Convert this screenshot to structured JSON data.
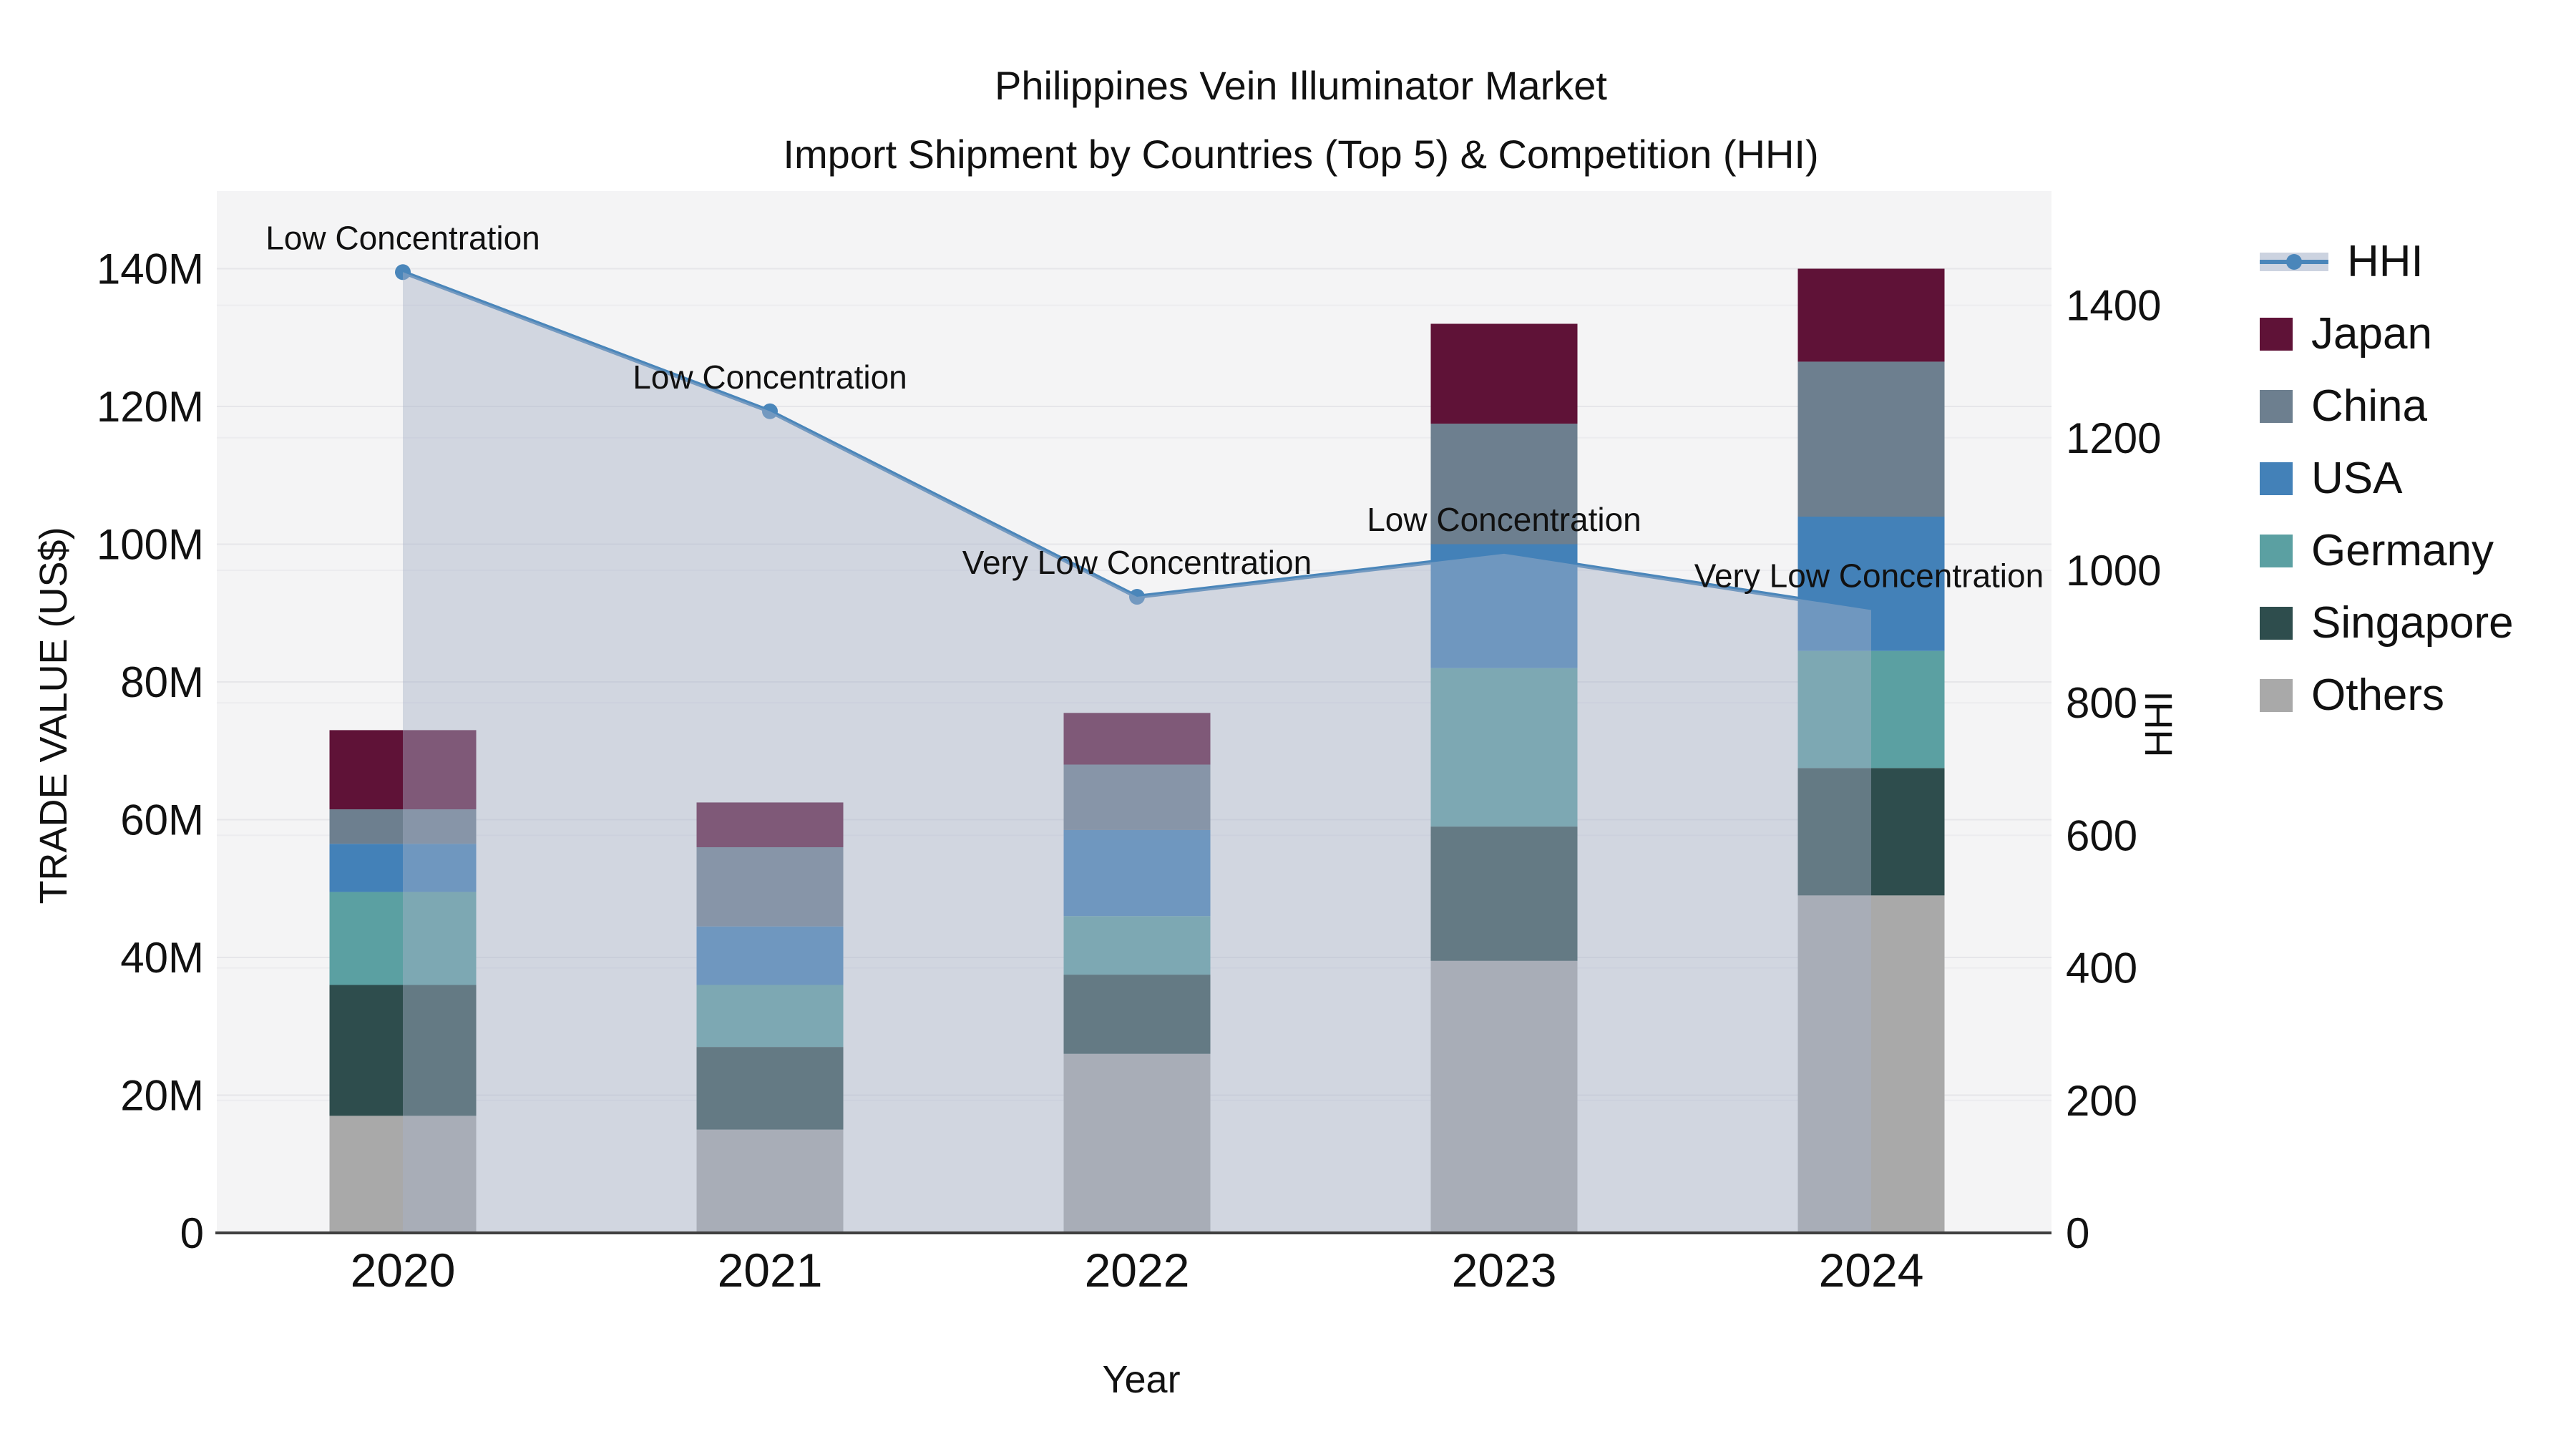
{
  "title": {
    "line1": "Philippines Vein Illuminator Market",
    "line2": "Import Shipment by Countries (Top 5) & Competition (HHI)"
  },
  "axes": {
    "left": {
      "label": "TRADE VALUE (US$)",
      "tick_labels": [
        "0",
        "20M",
        "40M",
        "60M",
        "80M",
        "100M",
        "120M",
        "140M"
      ],
      "tick_values": [
        0,
        20,
        40,
        60,
        80,
        100,
        120,
        140
      ]
    },
    "right": {
      "label": "HHI",
      "tick_labels": [
        "0",
        "200",
        "400",
        "600",
        "800",
        "1000",
        "1200",
        "1400"
      ],
      "tick_values": [
        0,
        200,
        400,
        600,
        800,
        1000,
        1200,
        1400
      ]
    },
    "x": {
      "label": "Year"
    }
  },
  "legend": [
    {
      "label": "HHI",
      "type": "line",
      "color": "#4a86ba"
    },
    {
      "label": "Japan",
      "type": "box",
      "color": "#5f1237"
    },
    {
      "label": "China",
      "type": "box",
      "color": "#6d7f8f"
    },
    {
      "label": "USA",
      "type": "box",
      "color": "#4381b8"
    },
    {
      "label": "Germany",
      "type": "box",
      "color": "#5ba0a2"
    },
    {
      "label": "Singapore",
      "type": "box",
      "color": "#2e4d4d"
    },
    {
      "label": "Others",
      "type": "box",
      "color": "#a9a9a9"
    }
  ],
  "chart_data": {
    "type": "bar",
    "subtype": "stacked bars with overlaid line + area fill",
    "title": "Philippines Vein Illuminator Market — Import Shipment by Countries (Top 5) & Competition (HHI)",
    "xlabel": "Year",
    "ylabel_left": "TRADE VALUE (US$)",
    "ylabel_right": "HHI",
    "ylim_left_millions": [
      0,
      151
    ],
    "ylim_right": [
      0,
      1570
    ],
    "grid": true,
    "legend_position": "right",
    "categories": [
      "2020",
      "2021",
      "2022",
      "2023",
      "2024"
    ],
    "series": [
      {
        "name": "Others",
        "color": "#a9a9a9",
        "values_musd": [
          17.0,
          15.0,
          26.0,
          39.5,
          49.0
        ]
      },
      {
        "name": "Singapore",
        "color": "#2e4d4d",
        "values_musd": [
          19.0,
          12.0,
          11.5,
          19.5,
          18.5
        ]
      },
      {
        "name": "Germany",
        "color": "#5ba0a2",
        "values_musd": [
          13.5,
          9.0,
          8.5,
          23.0,
          17.0
        ]
      },
      {
        "name": "USA",
        "color": "#4381b8",
        "values_musd": [
          7.0,
          8.5,
          12.5,
          18.0,
          19.5
        ]
      },
      {
        "name": "China",
        "color": "#6d7f8f",
        "values_musd": [
          5.0,
          11.5,
          9.5,
          17.5,
          22.5
        ]
      },
      {
        "name": "Japan",
        "color": "#5f1237",
        "values_musd": [
          11.5,
          6.5,
          7.5,
          14.5,
          13.5
        ]
      }
    ],
    "bar_totals_musd": [
      73.0,
      62.5,
      75.5,
      132.0,
      140.0
    ],
    "line_series": {
      "name": "HHI",
      "color": "#4a86ba",
      "area_fill": "rgba(167,177,199,0.45)",
      "values": [
        1450,
        1240,
        960,
        1025,
        940
      ]
    },
    "annotations": [
      {
        "x": "2020",
        "text": "Low Concentration"
      },
      {
        "x": "2021",
        "text": "Low Concentration"
      },
      {
        "x": "2022",
        "text": "Very Low Concentration"
      },
      {
        "x": "2023",
        "text": "Low Concentration"
      },
      {
        "x": "2024",
        "text": "Very Low Concentration"
      }
    ]
  },
  "colors": {
    "plot_bg": "#f4f4f5",
    "grid_left": "#e6e6e9",
    "grid_right": "#ececef",
    "axis_line": "#3f3f3f",
    "text": "#111111",
    "hhi_line": "#4a86ba",
    "hhi_fill": "rgba(167,177,199,0.45)"
  }
}
